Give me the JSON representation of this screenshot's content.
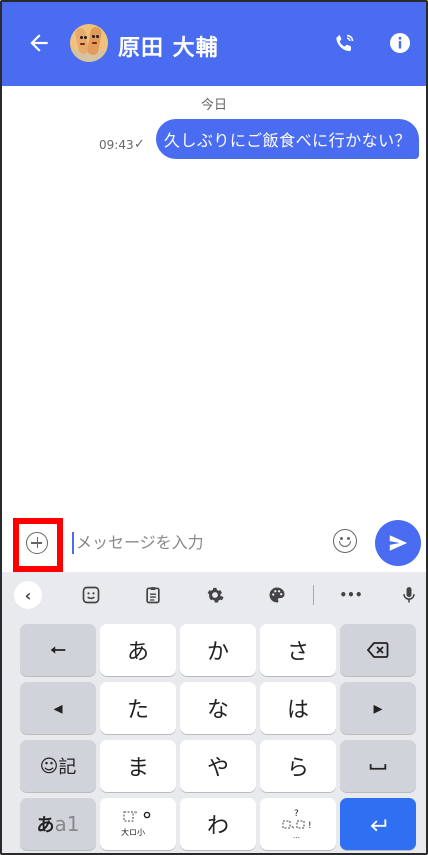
{
  "header": {
    "title": "原田 大輔"
  },
  "chat": {
    "date": "今日",
    "messages": [
      {
        "text": "久しぶりにご飯食べに行かない？",
        "time": "09:43",
        "status": "✓"
      }
    ]
  },
  "composer": {
    "placeholder": "メッセージを入力"
  },
  "keyboard": {
    "toolbar_more": "•••",
    "rows": [
      [
        "←",
        "あ",
        "か",
        "さ",
        "⌫"
      ],
      [
        "◂",
        "た",
        "な",
        "は",
        "▸"
      ],
      [
        "☺記",
        "ま",
        "や",
        "ら",
        "⎵"
      ],
      [
        "あa1",
        "゛゜大ロ小",
        "わ",
        "、。?!",
        "↵"
      ]
    ],
    "key_a1_kana": "あ",
    "key_a1_alnum": "a1",
    "key_ki": "記",
    "key_wa": "わ"
  },
  "colors": {
    "accent": "#4a6cf0",
    "enter_key": "#2f6ff2",
    "highlight": "#ff0000"
  },
  "icons": [
    "back-arrow-icon",
    "avatar",
    "phone-call-icon",
    "info-icon",
    "add-icon",
    "emoji-icon",
    "send-icon",
    "chevron-left-icon",
    "sticker-icon",
    "clipboard-icon",
    "settings-icon",
    "palette-icon",
    "more-icon",
    "mic-icon"
  ]
}
